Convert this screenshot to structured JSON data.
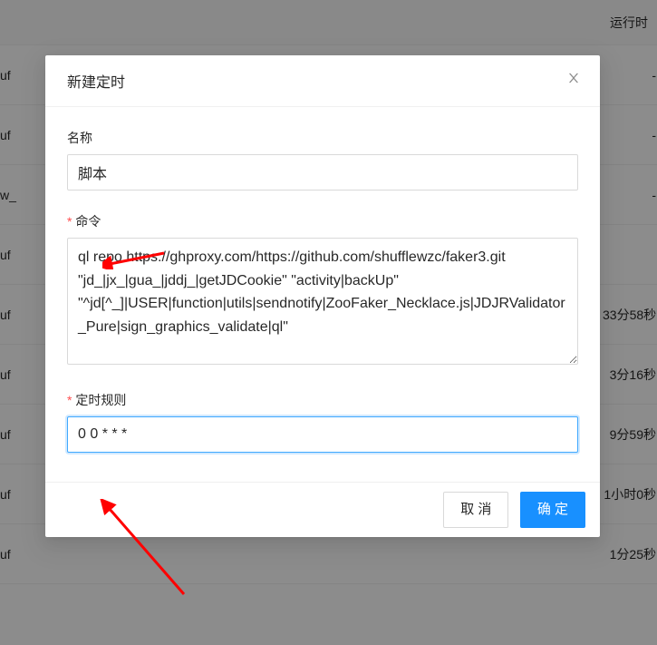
{
  "background": {
    "header_col": "运行时",
    "rows": [
      {
        "left": "uf",
        "right": "-"
      },
      {
        "left": "uf",
        "right": "-"
      },
      {
        "left": "w_",
        "right": "-"
      },
      {
        "left": "uf",
        "right": ""
      },
      {
        "left": "uf",
        "right": "33分58秒"
      },
      {
        "left": "uf",
        "right": "3分16秒"
      },
      {
        "left": "uf",
        "right": "9分59秒"
      },
      {
        "left": "uf",
        "right": "1小时0秒"
      },
      {
        "left": "uf",
        "right": "1分25秒"
      }
    ]
  },
  "modal": {
    "title": "新建定时",
    "name_label": "名称",
    "name_value": "脚本",
    "command_label": "命令",
    "command_value": "ql repo https://ghproxy.com/https://github.com/shufflewzc/faker3.git \"jd_|jx_|gua_|jddj_|getJDCookie\" \"activity|backUp\" \"^jd[^_]|USER|function|utils|sendnotify|ZooFaker_Necklace.js|JDJRValidator_Pure|sign_graphics_validate|ql\"",
    "schedule_label": "定时规则",
    "schedule_value": "0 0 * * *",
    "cancel_label": "取 消",
    "confirm_label": "确 定"
  }
}
